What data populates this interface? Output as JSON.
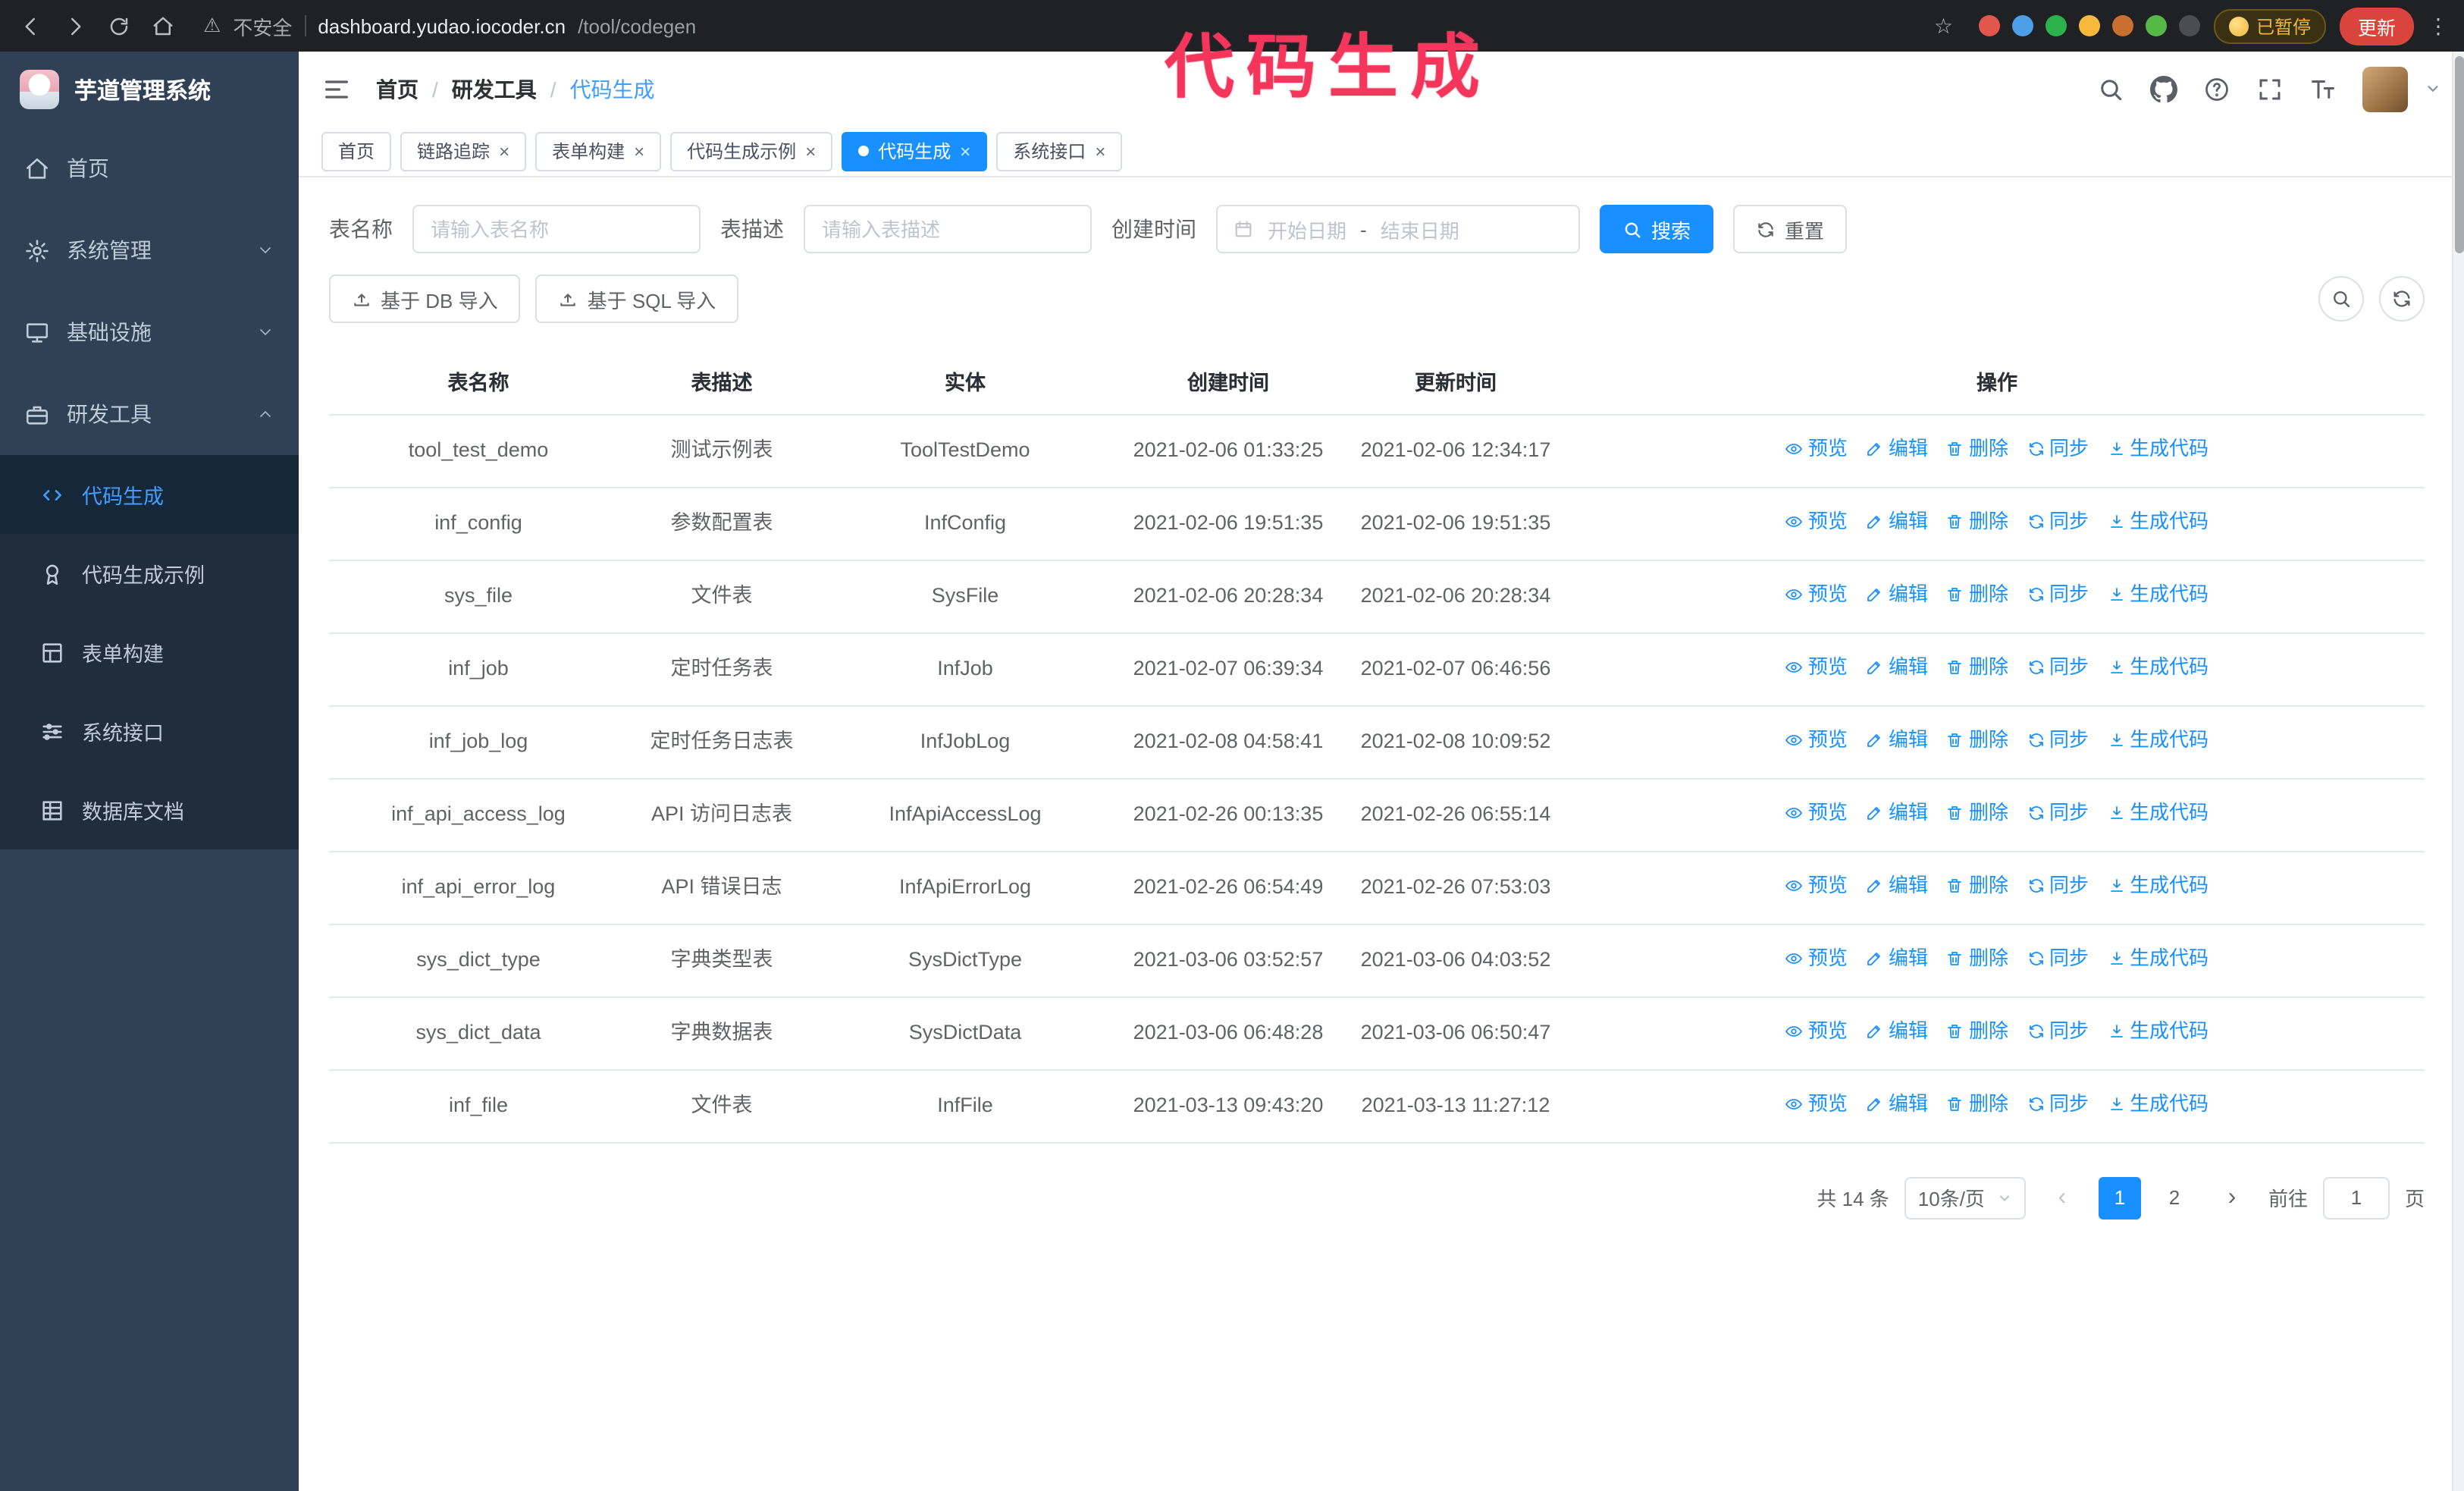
{
  "browser": {
    "security_label": "不安全",
    "url_host": "dashboard.yudao.iocoder.cn",
    "url_path": "/tool/codegen",
    "paused_badge": "已暂停",
    "update_button": "更新",
    "extensions": [
      {
        "color": "#e2574c"
      },
      {
        "color": "#4d9fe8"
      },
      {
        "color": "#2bb24c"
      },
      {
        "color": "#f6b93b"
      },
      {
        "color": "#c96f2f"
      },
      {
        "color": "#56b847"
      },
      {
        "color": "#4a4d52"
      }
    ]
  },
  "annotation": {
    "text": "代码生成",
    "color": "#f5365c"
  },
  "sidebar": {
    "logo_title": "芋道管理系统",
    "items": [
      {
        "key": "home",
        "label": "首页",
        "icon": "home-icon"
      },
      {
        "key": "system",
        "label": "系统管理",
        "icon": "gear-icon",
        "chevron": "down"
      },
      {
        "key": "infra",
        "label": "基础设施",
        "icon": "monitor-icon",
        "chevron": "down"
      },
      {
        "key": "devtools",
        "label": "研发工具",
        "icon": "toolbox-icon",
        "chevron": "up",
        "children": [
          {
            "key": "codegen",
            "label": "代码生成",
            "icon": "code-icon",
            "active": true
          },
          {
            "key": "codegen-demo",
            "label": "代码生成示例",
            "icon": "badge-icon"
          },
          {
            "key": "form-builder",
            "label": "表单构建",
            "icon": "form-icon"
          },
          {
            "key": "api",
            "label": "系统接口",
            "icon": "sliders-icon"
          },
          {
            "key": "db-doc",
            "label": "数据库文档",
            "icon": "table-grid-icon"
          }
        ]
      }
    ]
  },
  "header": {
    "breadcrumb": [
      "首页",
      "研发工具",
      "代码生成"
    ],
    "breadcrumb_separator": "/"
  },
  "tabs": [
    {
      "key": "home",
      "label": "首页",
      "closable": false,
      "active": false
    },
    {
      "key": "tracer",
      "label": "链路追踪",
      "closable": true,
      "active": false
    },
    {
      "key": "form-builder",
      "label": "表单构建",
      "closable": true,
      "active": false
    },
    {
      "key": "codegen-demo",
      "label": "代码生成示例",
      "closable": true,
      "active": false
    },
    {
      "key": "codegen",
      "label": "代码生成",
      "closable": true,
      "active": true
    },
    {
      "key": "api",
      "label": "系统接口",
      "closable": true,
      "active": false
    }
  ],
  "filters": {
    "table_name_label": "表名称",
    "table_name_placeholder": "请输入表名称",
    "table_desc_label": "表描述",
    "table_desc_placeholder": "请输入表描述",
    "create_time_label": "创建时间",
    "date_start_placeholder": "开始日期",
    "date_separator": "-",
    "date_end_placeholder": "结束日期",
    "search_button": "搜索",
    "reset_button": "重置"
  },
  "toolbar": {
    "import_db_button": "基于 DB 导入",
    "import_sql_button": "基于 SQL 导入"
  },
  "table": {
    "columns": [
      "表名称",
      "表描述",
      "实体",
      "创建时间",
      "更新时间",
      "操作"
    ],
    "actions": [
      "预览",
      "编辑",
      "删除",
      "同步",
      "生成代码"
    ],
    "rows": [
      {
        "name": "tool_test_demo",
        "desc": "测试示例表",
        "entity": "ToolTestDemo",
        "created": "2021-02-06 01:33:25",
        "updated": "2021-02-06 12:34:17"
      },
      {
        "name": "inf_config",
        "desc": "参数配置表",
        "entity": "InfConfig",
        "created": "2021-02-06 19:51:35",
        "updated": "2021-02-06 19:51:35"
      },
      {
        "name": "sys_file",
        "desc": "文件表",
        "entity": "SysFile",
        "created": "2021-02-06 20:28:34",
        "updated": "2021-02-06 20:28:34"
      },
      {
        "name": "inf_job",
        "desc": "定时任务表",
        "entity": "InfJob",
        "created": "2021-02-07 06:39:34",
        "updated": "2021-02-07 06:46:56"
      },
      {
        "name": "inf_job_log",
        "desc": "定时任务日志表",
        "entity": "InfJobLog",
        "created": "2021-02-08 04:58:41",
        "updated": "2021-02-08 10:09:52"
      },
      {
        "name": "inf_api_access_log",
        "desc": "API 访问日志表",
        "entity": "InfApiAccessLog",
        "created": "2021-02-26 00:13:35",
        "updated": "2021-02-26 06:55:14"
      },
      {
        "name": "inf_api_error_log",
        "desc": "API 错误日志",
        "entity": "InfApiErrorLog",
        "created": "2021-02-26 06:54:49",
        "updated": "2021-02-26 07:53:03"
      },
      {
        "name": "sys_dict_type",
        "desc": "字典类型表",
        "entity": "SysDictType",
        "created": "2021-03-06 03:52:57",
        "updated": "2021-03-06 04:03:52"
      },
      {
        "name": "sys_dict_data",
        "desc": "字典数据表",
        "entity": "SysDictData",
        "created": "2021-03-06 06:48:28",
        "updated": "2021-03-06 06:50:47"
      },
      {
        "name": "inf_file",
        "desc": "文件表",
        "entity": "InfFile",
        "created": "2021-03-13 09:43:20",
        "updated": "2021-03-13 11:27:12"
      }
    ]
  },
  "pagination": {
    "total_text": "共 14 条",
    "page_size": "10条/页",
    "pages": [
      "1",
      "2"
    ],
    "active_page": "1",
    "goto_prefix": "前往",
    "goto_value": "1",
    "goto_suffix": "页"
  }
}
